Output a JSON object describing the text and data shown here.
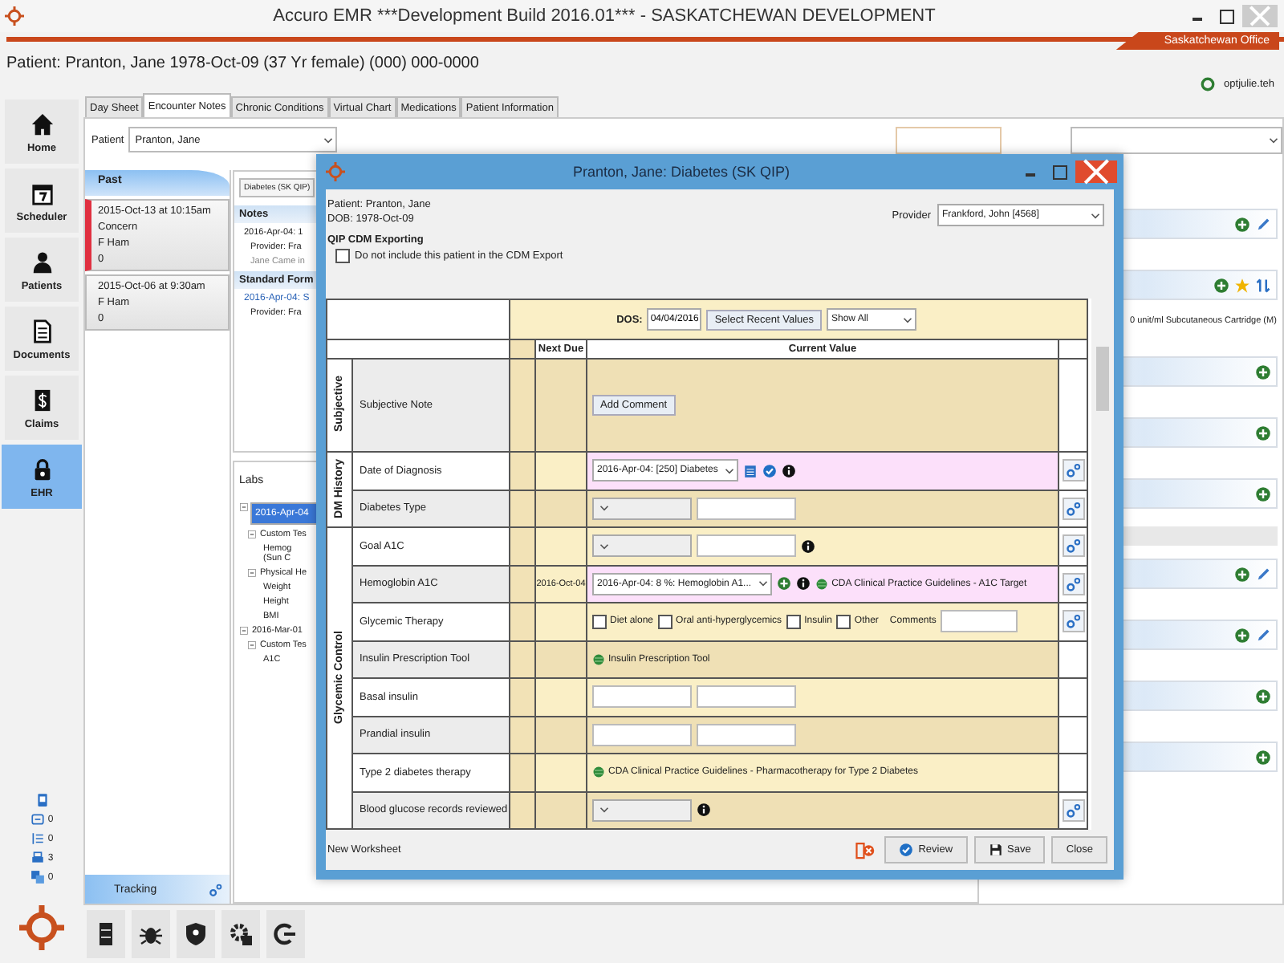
{
  "window": {
    "title": "Accuro EMR ***Development Build 2016.01*** - SASKATCHEWAN DEVELOPMENT"
  },
  "office": "Saskatchewan Office",
  "patient_banner": "Patient: Pranton, Jane 1978-Oct-09 (37 Yr female)  (000) 000-0000",
  "user": "optjulie.teh",
  "nav": [
    {
      "label": "Home",
      "selected": false
    },
    {
      "label": "Scheduler",
      "selected": false
    },
    {
      "label": "Patients",
      "selected": false
    },
    {
      "label": "Documents",
      "selected": false
    },
    {
      "label": "Claims",
      "selected": false
    },
    {
      "label": "EHR",
      "selected": true
    }
  ],
  "counters": [
    "0",
    "0",
    "3",
    "0"
  ],
  "tabs": [
    {
      "label": "Day Sheet",
      "selected": false
    },
    {
      "label": "Encounter Notes",
      "selected": true
    },
    {
      "label": "Chronic Conditions",
      "selected": false
    },
    {
      "label": "Virtual Chart",
      "selected": false
    },
    {
      "label": "Medications",
      "selected": false
    },
    {
      "label": "Patient Information",
      "selected": false
    }
  ],
  "patient_field": {
    "label": "Patient",
    "value": "Pranton, Jane"
  },
  "encounters": {
    "header": "Past",
    "items": [
      {
        "lines": [
          "2015-Oct-13 at 10:15am",
          "Concern",
          "F Ham",
          "0"
        ],
        "selected": true
      },
      {
        "lines": [
          "2015-Oct-06 at 9:30am",
          "F Ham",
          "0"
        ],
        "selected": false
      }
    ]
  },
  "tracking": "Tracking",
  "middle": {
    "tab": "Diabetes (SK QIP)",
    "notes": {
      "header": "Notes",
      "lines": [
        {
          "kind": "date",
          "text": "2016-Apr-04: 1"
        },
        {
          "kind": "provider",
          "text": "Provider: Fra"
        },
        {
          "kind": "muted",
          "text": "Jane Came in"
        }
      ]
    },
    "forms": {
      "header": "Standard Form",
      "lines": [
        {
          "kind": "link",
          "text": "2016-Apr-04: S"
        },
        {
          "kind": "provider",
          "text": "Provider: Fra"
        }
      ]
    },
    "labs": {
      "title": "Labs",
      "tree": [
        {
          "label": "2016-Apr-04",
          "selected": true,
          "expanded": true,
          "children": [
            {
              "label": "Custom Tes",
              "selected": false,
              "expanded": true,
              "children": [
                {
                  "label": "Hemog\n(Sun C",
                  "selected": false
                }
              ]
            },
            {
              "label": "Physical He",
              "selected": false,
              "expanded": true,
              "children": [
                {
                  "label": "Weight",
                  "selected": false
                },
                {
                  "label": "Height",
                  "selected": false
                },
                {
                  "label": "BMI",
                  "selected": false
                }
              ]
            }
          ]
        },
        {
          "label": "2016-Mar-01",
          "selected": false,
          "expanded": true,
          "children": [
            {
              "label": "Custom Tes",
              "selected": false,
              "expanded": true,
              "children": [
                {
                  "label": "A1C",
                  "selected": false
                }
              ]
            }
          ]
        }
      ]
    }
  },
  "right_panel": {
    "rows": [
      {
        "kind": "editable"
      },
      {
        "kind": "favorite",
        "note": "0 unit/ml Subcutaneous Cartridge (M)"
      },
      {
        "kind": "plain"
      },
      {
        "kind": "plain"
      },
      {
        "kind": "plain"
      },
      {
        "kind": "group"
      },
      {
        "kind": "editable"
      },
      {
        "kind": "editable"
      },
      {
        "kind": "plain"
      },
      {
        "kind": "plain"
      }
    ]
  },
  "dialog": {
    "title": "Pranton, Jane: Diabetes (SK QIP)",
    "patient": "Patient: Pranton, Jane",
    "dob": "DOB: 1978-Oct-09",
    "export_heading": "QIP CDM Exporting",
    "export_checkbox": {
      "label": "Do not include this patient in the CDM Export",
      "checked": false
    },
    "provider": {
      "label": "Provider",
      "value": "Frankford, John [4568]"
    },
    "dos": {
      "label": "DOS:",
      "value": "04/04/2016"
    },
    "recent_button": "Select Recent Values",
    "filter": "Show All",
    "columns": {
      "next_due": "Next Due",
      "current_value": "Current Value"
    },
    "sections": [
      {
        "title": "Subjective",
        "rows": [
          {
            "label": "Subjective Note",
            "highlighted": false,
            "settings": false,
            "controls": [
              {
                "kind": "button",
                "label": "Add Comment"
              }
            ]
          }
        ]
      },
      {
        "title": "DM History",
        "rows": [
          {
            "label": "Date of Diagnosis",
            "highlighted": true,
            "settings": true,
            "controls": [
              {
                "kind": "select",
                "value": "2016-Apr-04: [250] Diabetes"
              },
              {
                "kind": "calendar"
              },
              {
                "kind": "check"
              },
              {
                "kind": "info"
              }
            ]
          },
          {
            "label": "Diabetes Type",
            "highlighted": false,
            "settings": true,
            "controls": [
              {
                "kind": "select"
              },
              {
                "kind": "input"
              }
            ]
          }
        ]
      },
      {
        "title": "Glycemic Control",
        "rows": [
          {
            "label": "Goal A1C",
            "highlighted": false,
            "settings": true,
            "controls": [
              {
                "kind": "select"
              },
              {
                "kind": "input"
              },
              {
                "kind": "info"
              }
            ]
          },
          {
            "label": "Hemoglobin A1C",
            "next_due": "2016-Oct-04",
            "highlighted": true,
            "settings": true,
            "controls": [
              {
                "kind": "select",
                "value": "2016-Apr-04: 8 %: Hemoglobin A1..."
              },
              {
                "kind": "plus"
              },
              {
                "kind": "info"
              },
              {
                "kind": "link",
                "label": "CDA Clinical Practice Guidelines - A1C Target"
              }
            ]
          },
          {
            "label": "Glycemic Therapy",
            "highlighted": false,
            "settings": true,
            "controls": [
              {
                "kind": "checkbox",
                "label": "Diet alone",
                "checked": false
              },
              {
                "kind": "checkbox",
                "label": "Oral anti-hyperglycemics",
                "checked": false
              },
              {
                "kind": "checkbox",
                "label": "Insulin",
                "checked": false
              },
              {
                "kind": "checkbox",
                "label": "Other",
                "checked": false
              },
              {
                "kind": "field",
                "label": "Comments"
              }
            ]
          },
          {
            "label": "Insulin Prescription Tool",
            "highlighted": false,
            "settings": false,
            "controls": [
              {
                "kind": "link",
                "label": "Insulin Prescription Tool"
              }
            ]
          },
          {
            "label": "Basal insulin",
            "highlighted": false,
            "settings": false,
            "controls": [
              {
                "kind": "input"
              },
              {
                "kind": "input"
              }
            ]
          },
          {
            "label": "Prandial insulin",
            "highlighted": false,
            "settings": false,
            "controls": [
              {
                "kind": "input"
              },
              {
                "kind": "input"
              }
            ]
          },
          {
            "label": "Type 2 diabetes therapy",
            "highlighted": false,
            "settings": false,
            "controls": [
              {
                "kind": "link",
                "label": "CDA Clinical Practice Guidelines - Pharmacotherapy for Type 2 Diabetes"
              }
            ]
          },
          {
            "label": "Blood glucose records reviewed",
            "highlighted": false,
            "settings": true,
            "controls": [
              {
                "kind": "select"
              },
              {
                "kind": "info"
              }
            ]
          }
        ]
      }
    ],
    "footer": {
      "status": "New Worksheet",
      "buttons": [
        {
          "kind": "review",
          "label": "Review"
        },
        {
          "kind": "save",
          "label": "Save"
        },
        {
          "kind": "close",
          "label": "Close"
        }
      ]
    }
  }
}
